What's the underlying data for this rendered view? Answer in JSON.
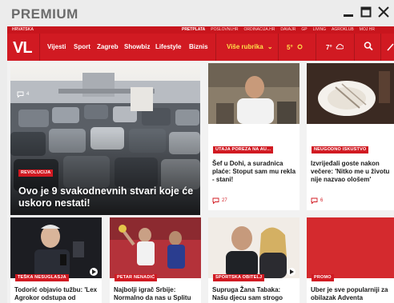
{
  "window": {
    "title": "PREMIUM"
  },
  "topbar": {
    "city": "HRVATSKA",
    "links": [
      "PRETPLATA",
      "POSLOVNI.HR",
      "ORDINACIJA.HR",
      "DAVAJR",
      "GP",
      "LIVING",
      "AGROKLUB",
      "MOJ HR"
    ]
  },
  "navbar": {
    "logo": "VL",
    "items": [
      "Vijesti",
      "Sport",
      "Zagreb",
      "Showbiz",
      "Lifestyle",
      "Biznis"
    ],
    "more": "Više rubrika",
    "temp1": "5°",
    "temp2": "7°"
  },
  "hero": {
    "tag": "REVOLUCIJA",
    "title": "Ovo je 9 svakodnevnih stvari koje će uskoro nestati!",
    "comments": "4"
  },
  "cards": [
    {
      "tag": "UTAJA POREZA NA AU...",
      "title": "Šef u Dohi, a suradnica plaće: Stoput sam mu rekla - stani!",
      "comments": "27"
    },
    {
      "tag": "NEUGODNO ISKUSTVO",
      "title": "Izvrijeđali goste nakon večere: 'Nitko me u životu nije nazvao ološem'",
      "comments": "6"
    },
    {
      "tag": "TEŠKA NESUGLASJA",
      "title": "Todorić objavio tužbu: 'Lex Agrokor odstupa od europskog prava'",
      "comments": ""
    },
    {
      "tag": "PETAR NENADIĆ",
      "title": "Najbolji igrač Srbije: Normalno da nas u Splitu neće dočekati s pljeskom",
      "comments": ""
    },
    {
      "tag": "SPORTSKA OBITELJ",
      "title": "Supruga Žana Tabaka: Našu djecu sam strogo odgajala",
      "comments": ""
    },
    {
      "tag": "PROMO",
      "title": "Uber je sve popularniji za obilazak Adventa",
      "comments": ""
    }
  ],
  "colors": {
    "brand_red": "#d11a22",
    "nav_highlight": "#ffe14a"
  }
}
